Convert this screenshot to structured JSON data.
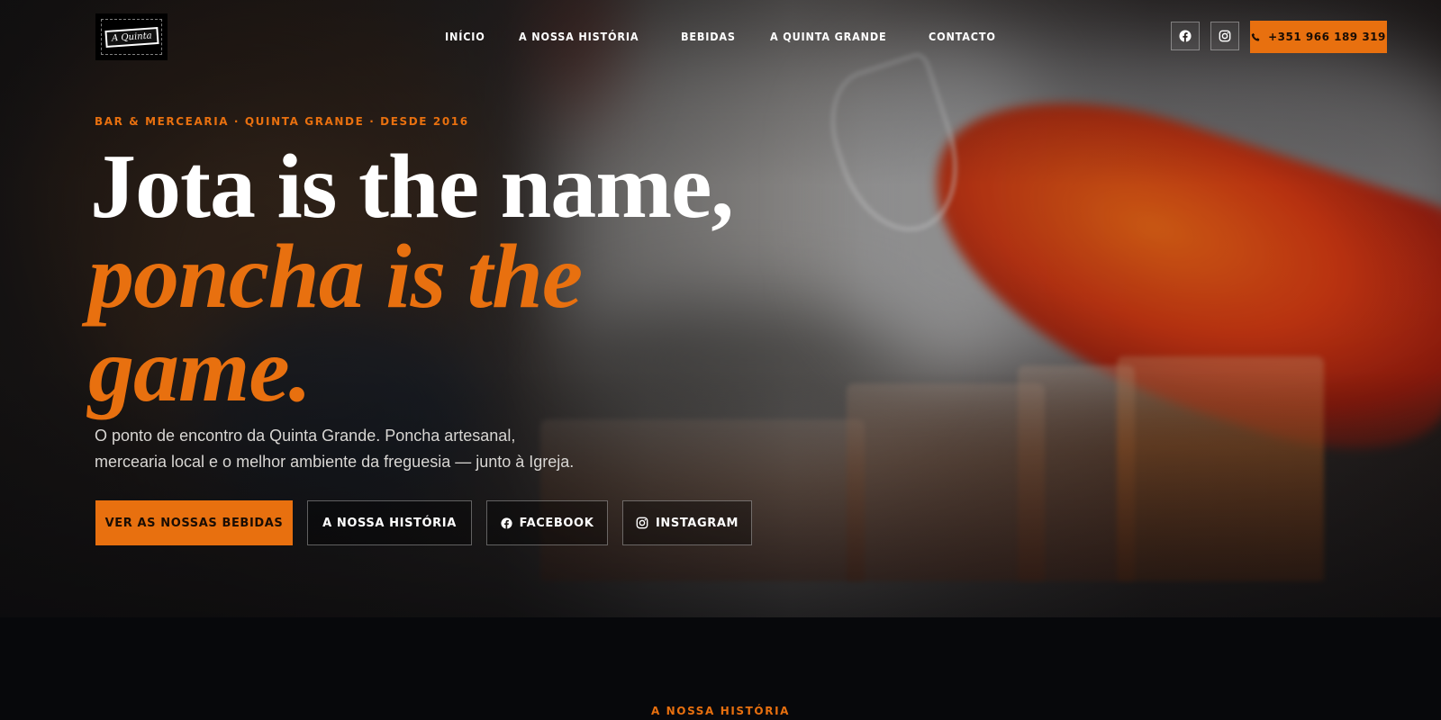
{
  "brand": {
    "logo_text": "A Quinta"
  },
  "nav": {
    "items": [
      "INÍCIO",
      "A NOSSA HISTÓRIA",
      "BEBIDAS",
      "A QUINTA GRANDE",
      "CONTACTO"
    ]
  },
  "header": {
    "phone_label": "+351 966 189 319",
    "social": [
      "facebook-icon",
      "instagram-icon"
    ]
  },
  "hero": {
    "eyebrow": "BAR & MERCEARIA · QUINTA GRANDE · DESDE 2016",
    "title_line1": "Jota is the name,",
    "title_accent_line1": "poncha is the",
    "title_accent_line2": "game.",
    "subtitle_line1": "O ponto de encontro da Quinta Grande. Poncha artesanal,",
    "subtitle_line2": "mercearia local e o melhor ambiente da freguesia — junto à Igreja.",
    "buttons": {
      "drinks": "VER AS NOSSAS BEBIDAS",
      "story": "A NOSSA HISTÓRIA",
      "facebook": "FACEBOOK",
      "instagram": "INSTAGRAM"
    }
  },
  "next_section": {
    "label": "A NOSSA HISTÓRIA"
  },
  "colors": {
    "accent": "#e8700f",
    "background": "#07080b",
    "text": "#ffffff"
  }
}
